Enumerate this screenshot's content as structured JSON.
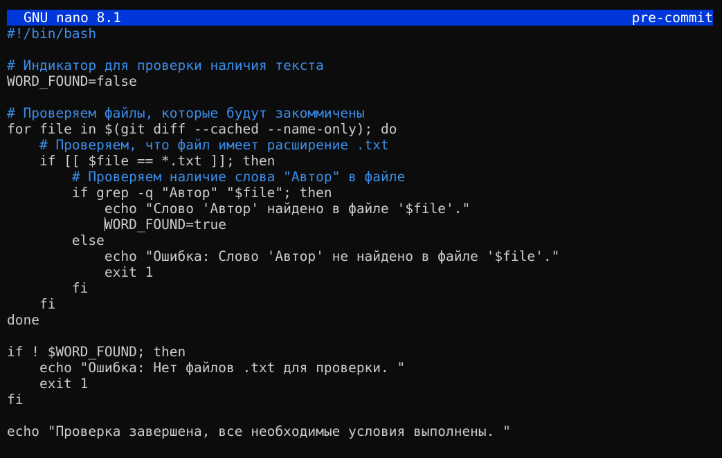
{
  "title_bar": {
    "app": "GNU nano 8.1",
    "file": "pre-commit",
    "background": "#0037da"
  },
  "colors": {
    "background": "#0c0c0c",
    "text": "#cccccc",
    "comment": "#3b8eea"
  },
  "lines": [
    {
      "text": "#!/bin/bash",
      "type": "shebang"
    },
    {
      "text": "",
      "type": "code"
    },
    {
      "text": "# Индикатор для проверки наличия текста",
      "type": "comment"
    },
    {
      "text": "WORD_FOUND=false",
      "type": "code"
    },
    {
      "text": "",
      "type": "code"
    },
    {
      "text": "# Проверяем файлы, которые будут закоммичены",
      "type": "comment"
    },
    {
      "text": "for file in $(git diff --cached --name-only); do",
      "type": "code"
    },
    {
      "text": "    # Проверяем, что файл имеет расширение .txt",
      "type": "comment"
    },
    {
      "text": "    if [[ $file == *.txt ]]; then",
      "type": "code"
    },
    {
      "text": "        # Проверяем наличие слова \"Автор\" в файле",
      "type": "comment"
    },
    {
      "text": "        if grep -q \"Автор\" \"$file\"; then",
      "type": "code"
    },
    {
      "text": "            echo \"Слово 'Автор' найдено в файле '$file'.\"",
      "type": "code"
    },
    {
      "text": "            WORD_FOUND=true",
      "type": "code",
      "cursor": true
    },
    {
      "text": "        else",
      "type": "code"
    },
    {
      "text": "            echo \"Ошибка: Слово 'Автор' не найдено в файле '$file'.\"",
      "type": "code"
    },
    {
      "text": "            exit 1",
      "type": "code"
    },
    {
      "text": "        fi",
      "type": "code"
    },
    {
      "text": "    fi",
      "type": "code"
    },
    {
      "text": "done",
      "type": "code"
    },
    {
      "text": "",
      "type": "code"
    },
    {
      "text": "if ! $WORD_FOUND; then",
      "type": "code"
    },
    {
      "text": "    echo \"Ошибка: Нет файлов .txt для проверки. \"",
      "type": "code"
    },
    {
      "text": "    exit 1",
      "type": "code"
    },
    {
      "text": "fi",
      "type": "code"
    },
    {
      "text": "",
      "type": "code"
    },
    {
      "text": "echo \"Проверка завершена, все необходимые условия выполнены. \"",
      "type": "code"
    }
  ]
}
